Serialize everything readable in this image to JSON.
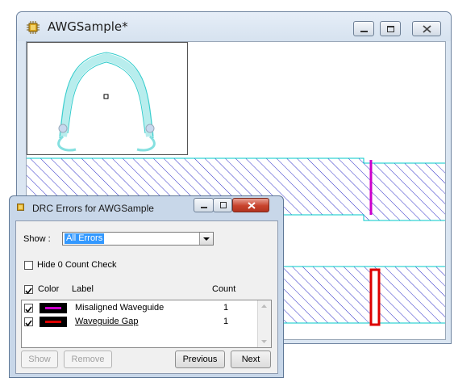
{
  "main_window": {
    "title": "AWGSample*",
    "icon": "app-chip-icon",
    "controls": [
      "minimize-icon",
      "maximize-icon",
      "close-icon"
    ]
  },
  "drc_dialog": {
    "title": "DRC Errors for AWGSample",
    "show_label": "Show :",
    "show_value": "All Errors",
    "hide_zero_label": "Hide 0 Count Check",
    "hide_zero_checked": false,
    "columns": {
      "color": "Color",
      "label": "Label",
      "count": "Count"
    },
    "rows": [
      {
        "checked": true,
        "color": "#cc00cc",
        "label": "Misaligned Waveguide",
        "count": "1",
        "underlined": false
      },
      {
        "checked": true,
        "color": "#dd0000",
        "label": "Waveguide Gap",
        "count": "1",
        "underlined": true
      }
    ],
    "buttons": {
      "show": "Show",
      "remove": "Remove",
      "previous": "Previous",
      "next": "Next"
    }
  },
  "colors": {
    "waveguide_hatch": "#3030c8",
    "waveguide_edge": "#00c8c8",
    "error_misaligned": "#cc00cc",
    "error_gap": "#dd0000"
  }
}
